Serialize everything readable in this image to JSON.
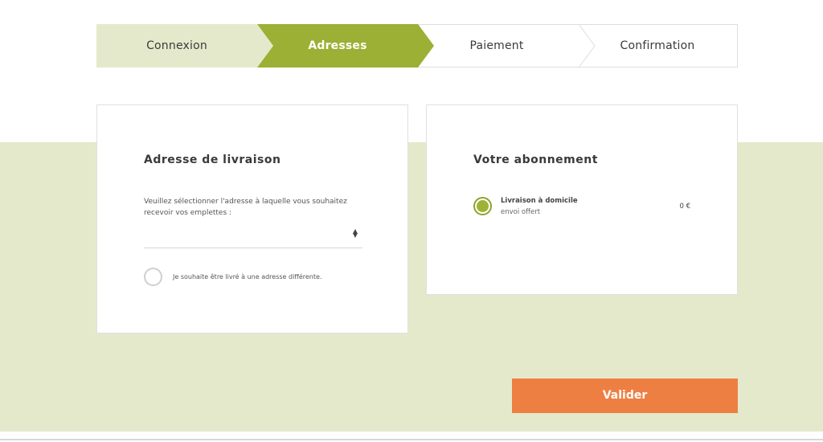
{
  "stepper": {
    "steps": [
      {
        "label": "Connexion",
        "state": "done"
      },
      {
        "label": "Adresses",
        "state": "active"
      },
      {
        "label": "Paiement",
        "state": "todo"
      },
      {
        "label": "Confirmation",
        "state": "todo"
      }
    ],
    "colors": {
      "done": "#e5e9cb",
      "active": "#9bb034",
      "todo": "#ffffff"
    }
  },
  "address_card": {
    "title": "Adresse de livraison",
    "intro": "Veuillez sélectionner l'adresse à laquelle vous souhaitez recevoir vos emplettes :",
    "select": {
      "selected_value": "",
      "icon": "updown-arrows-icon"
    },
    "different_address_label": "Je souhaite être livré à une adresse différente.",
    "different_address_checked": false
  },
  "subscription_card": {
    "title": "Votre abonnement",
    "option": {
      "title": "Livraison à domicile",
      "subtitle": "envoi offert",
      "price": "0 €",
      "checked": true
    }
  },
  "actions": {
    "submit_label": "Valider"
  },
  "colors": {
    "accent_green": "#9bb034",
    "band_green": "#e5e9cb",
    "button_orange": "#ee7f43"
  }
}
